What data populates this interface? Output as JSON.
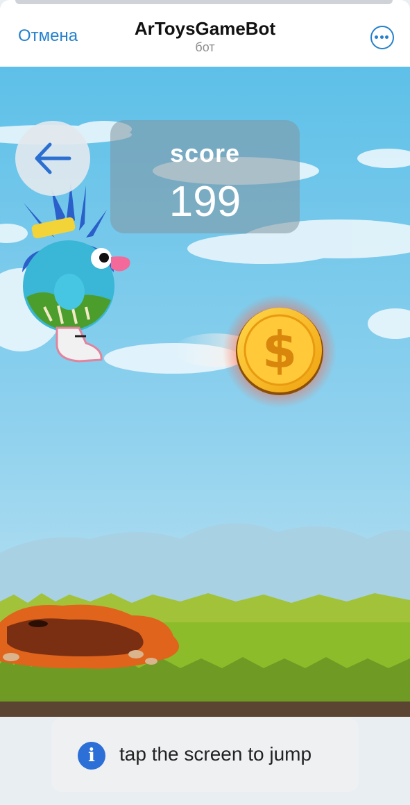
{
  "header": {
    "cancel_label": "Отмена",
    "title": "ArToysGameBot",
    "subtitle": "бот",
    "more_icon": "more-horizontal-icon"
  },
  "game": {
    "back_icon": "arrow-left-icon",
    "score_label": "score",
    "score_value": "199",
    "coin_icon": "dollar-coin-icon"
  },
  "toast": {
    "icon": "info-icon",
    "text": "tap the screen to jump"
  },
  "colors": {
    "accent": "#2481cc",
    "sky": "#6cc3e6",
    "grass": "#8cbc2a",
    "coin": "#f5b51c",
    "info_icon": "#2c6fd6"
  }
}
